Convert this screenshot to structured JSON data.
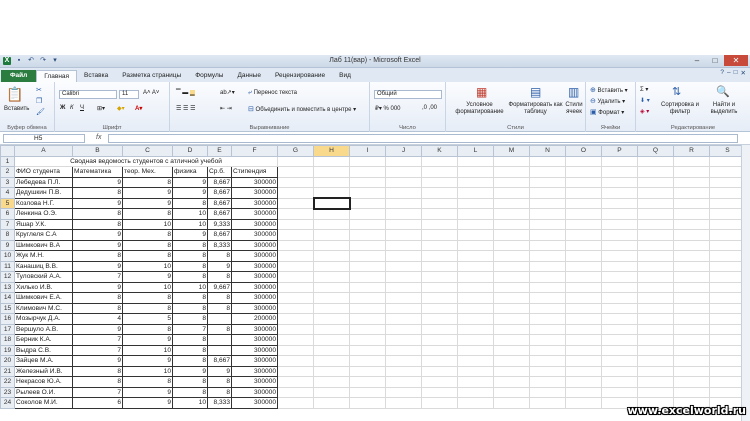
{
  "window": {
    "title": "Лаб 11(вар) - Microsoft Excel"
  },
  "ribbon_tabs": [
    "Файл",
    "Главная",
    "Вставка",
    "Разметка страницы",
    "Формулы",
    "Данные",
    "Рецензирование",
    "Вид"
  ],
  "ribbon": {
    "clipboard": {
      "paste": "Вставить",
      "label": "Буфер обмена"
    },
    "font": {
      "name": "Calibri",
      "size": "11",
      "label": "Шрифт"
    },
    "alignment": {
      "wrap": "Перенос текста",
      "merge": "Объединить и поместить в центре",
      "label": "Выравнивание"
    },
    "number": {
      "format": "Общий",
      "label": "Число"
    },
    "styles": {
      "conditional": "Условное форматирование",
      "as_table": "Форматировать как таблицу",
      "cell_styles": "Стили ячеек",
      "label": "Стили"
    },
    "cells": {
      "insert": "Вставить",
      "delete": "Удалить",
      "format": "Формат",
      "label": "Ячейки"
    },
    "editing": {
      "sort": "Сортировка и фильтр",
      "find": "Найти и выделить",
      "label": "Редактирование"
    }
  },
  "formula_bar": {
    "name_box": "H5",
    "fx": "fx",
    "content": ""
  },
  "sheet": {
    "columns": [
      "A",
      "B",
      "C",
      "D",
      "E",
      "F",
      "G",
      "H",
      "I",
      "J",
      "K",
      "L",
      "M",
      "N",
      "O",
      "P",
      "Q",
      "R",
      "S"
    ],
    "selected_cell": "H5",
    "title": "Сводная ведомость студентов с атличной учебой",
    "headers": [
      "ФИО студента",
      "Математика",
      "теор. Мех.",
      "физика",
      "Ср.б.",
      "Стипендия"
    ],
    "rows": [
      [
        "Лебедева П.Л.",
        "9",
        "8",
        "9",
        "8,667",
        "300000"
      ],
      [
        "Дедушкин П.В.",
        "8",
        "9",
        "9",
        "8,667",
        "300000"
      ],
      [
        "Козлова Н.Г.",
        "9",
        "9",
        "8",
        "8,667",
        "300000"
      ],
      [
        "Ленкина О.Э.",
        "8",
        "8",
        "10",
        "8,667",
        "300000"
      ],
      [
        "Яшар У.К.",
        "8",
        "10",
        "10",
        "9,333",
        "300000"
      ],
      [
        "Круглеля С.А",
        "9",
        "8",
        "9",
        "8,667",
        "300000"
      ],
      [
        "Шимкович В.А",
        "9",
        "8",
        "8",
        "8,333",
        "300000"
      ],
      [
        "Жук М.Н.",
        "8",
        "8",
        "8",
        "8",
        "300000"
      ],
      [
        "Канашиц В.В.",
        "9",
        "10",
        "8",
        "9",
        "300000"
      ],
      [
        "Туловский А.А.",
        "7",
        "9",
        "8",
        "8",
        "300000"
      ],
      [
        "Хилько И.В.",
        "9",
        "10",
        "10",
        "9,667",
        "300000"
      ],
      [
        "Шимкович Е.А.",
        "8",
        "8",
        "8",
        "8",
        "300000"
      ],
      [
        "Климович М.С.",
        "8",
        "8",
        "8",
        "8",
        "300000"
      ],
      [
        "Мозырчук Д.А.",
        "4",
        "5",
        "8",
        "5,667",
        "200000"
      ],
      [
        "Вершуло А.В.",
        "9",
        "8",
        "7",
        "8",
        "300000"
      ],
      [
        "Берник К.А.",
        "7",
        "9",
        "8",
        "8",
        "300000"
      ],
      [
        "Выдра С.В.",
        "7",
        "10",
        "8",
        "8,333",
        "300000"
      ],
      [
        "Зайцев М.А.",
        "9",
        "9",
        "8",
        "8,667",
        "300000"
      ],
      [
        "Железный И.В.",
        "8",
        "10",
        "9",
        "9",
        "300000"
      ],
      [
        "Некрасов Ю.А.",
        "8",
        "8",
        "8",
        "8",
        "300000"
      ],
      [
        "Рылеев О.И.",
        "7",
        "9",
        "8",
        "8",
        "300000"
      ],
      [
        "Соколов М.И.",
        "6",
        "9",
        "10",
        "8,333",
        "300000"
      ]
    ],
    "e_blank_rows": [
      13,
      15,
      16
    ]
  },
  "watermark": "www.excelworld.ru",
  "colors": {
    "file_tab": "#2a7d3f",
    "selection_header": "#f9d98b",
    "close_button": "#c84a3a"
  }
}
